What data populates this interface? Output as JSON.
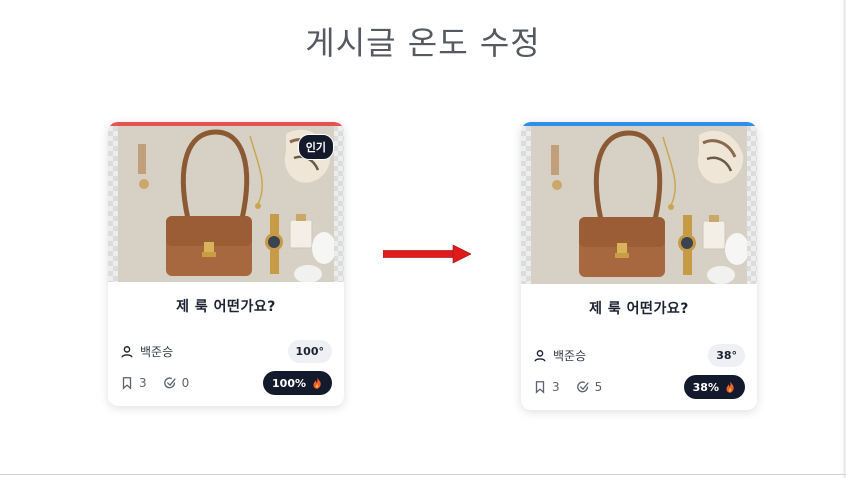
{
  "page": {
    "title": "게시글 온도 수정"
  },
  "colors": {
    "before_accent": "#e55252",
    "after_accent": "#2f8fe8",
    "arrow": "#e01b1b",
    "pill_dark": "#121a2b"
  },
  "before": {
    "badge": "인기",
    "title": "제 룩 어떤가요?",
    "author": "백준승",
    "temperature": "100°",
    "bookmarks": "3",
    "checks": "0",
    "heat": "100%"
  },
  "after": {
    "title": "제 룩 어떤가요?",
    "author": "백준승",
    "temperature": "38°",
    "bookmarks": "3",
    "checks": "5",
    "heat": "38%"
  },
  "icons": {
    "user": "user-icon",
    "bookmark": "bookmark-icon",
    "check": "check-circle-icon",
    "flame": "flame-icon",
    "arrow": "arrow-right-icon"
  }
}
